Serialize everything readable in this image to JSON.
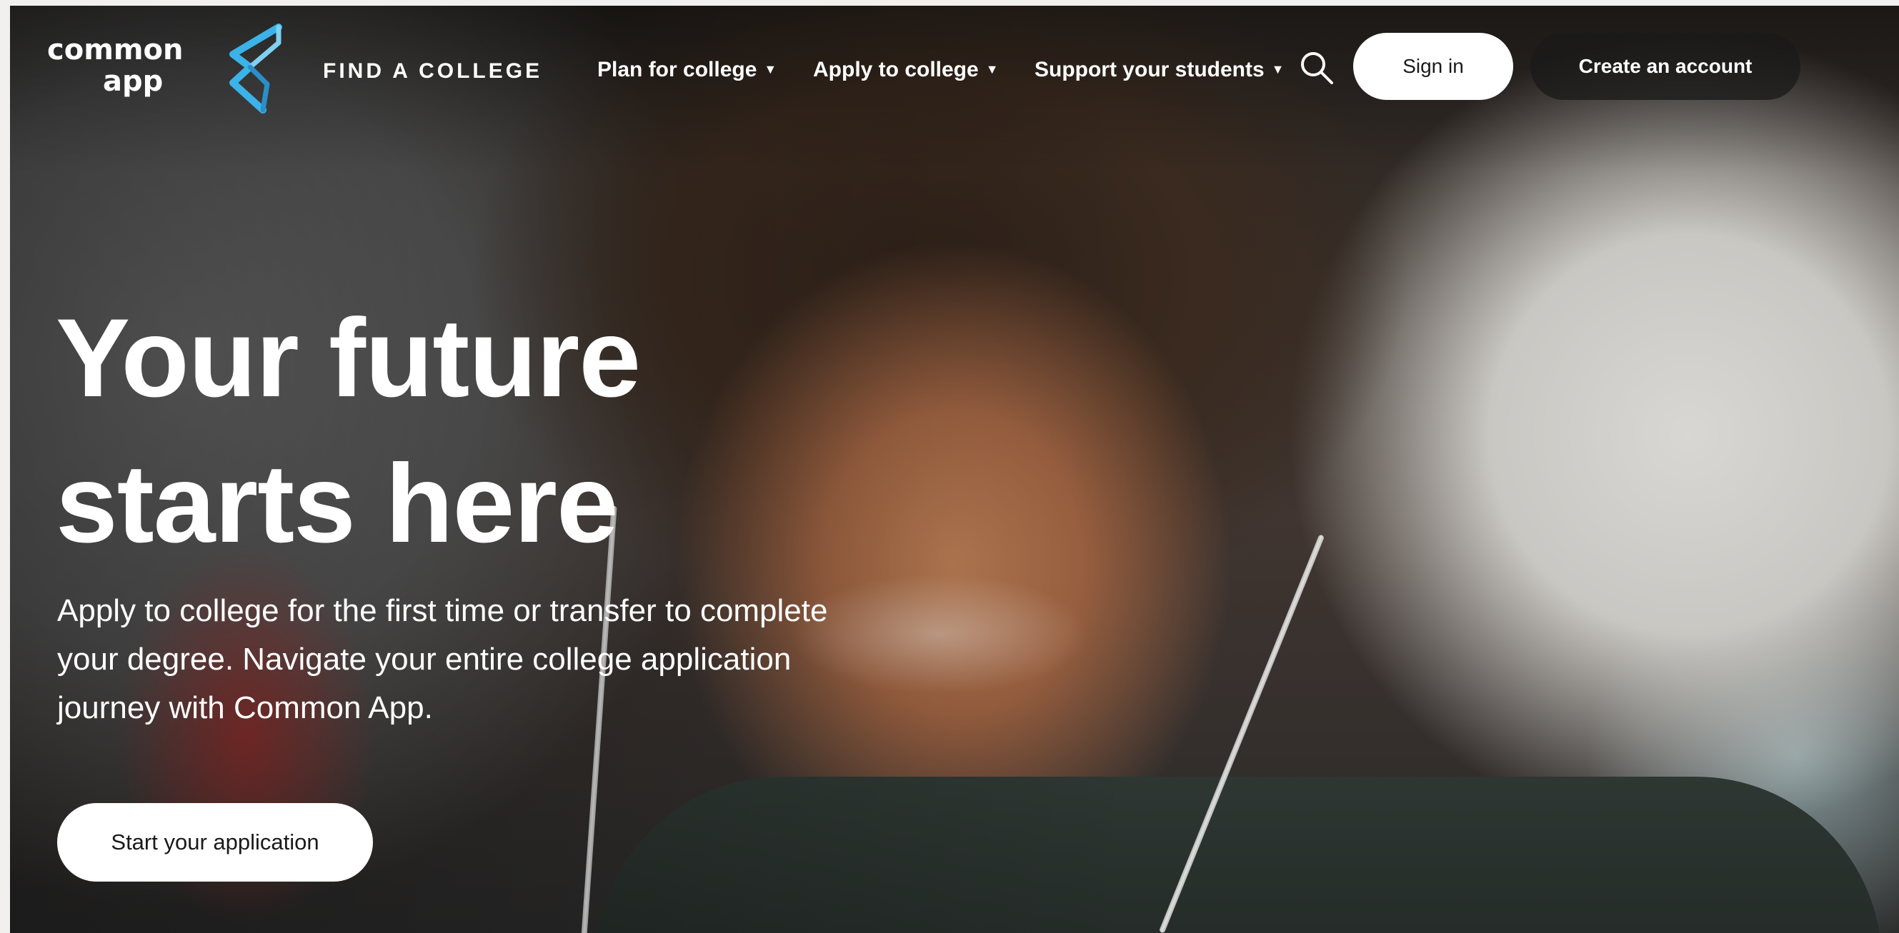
{
  "brand": {
    "logo_line1": "common",
    "logo_line2": "app",
    "accent_color": "#3bb3e8"
  },
  "nav": {
    "find_college": "FIND A COLLEGE",
    "items": [
      {
        "label": "Plan for college",
        "icon": "caret-down-icon"
      },
      {
        "label": "Apply to college",
        "icon": "caret-down-icon"
      },
      {
        "label": "Support your students",
        "icon": "caret-down-icon"
      }
    ],
    "search_icon": "search-icon",
    "sign_in_label": "Sign in",
    "create_account_label": "Create an account"
  },
  "hero": {
    "title_line1": "Your future",
    "title_line2": "starts here",
    "subtitle": "Apply to college for the first time or transfer to complete your degree. Navigate your entire college application journey with Common App.",
    "cta_label": "Start your application"
  }
}
